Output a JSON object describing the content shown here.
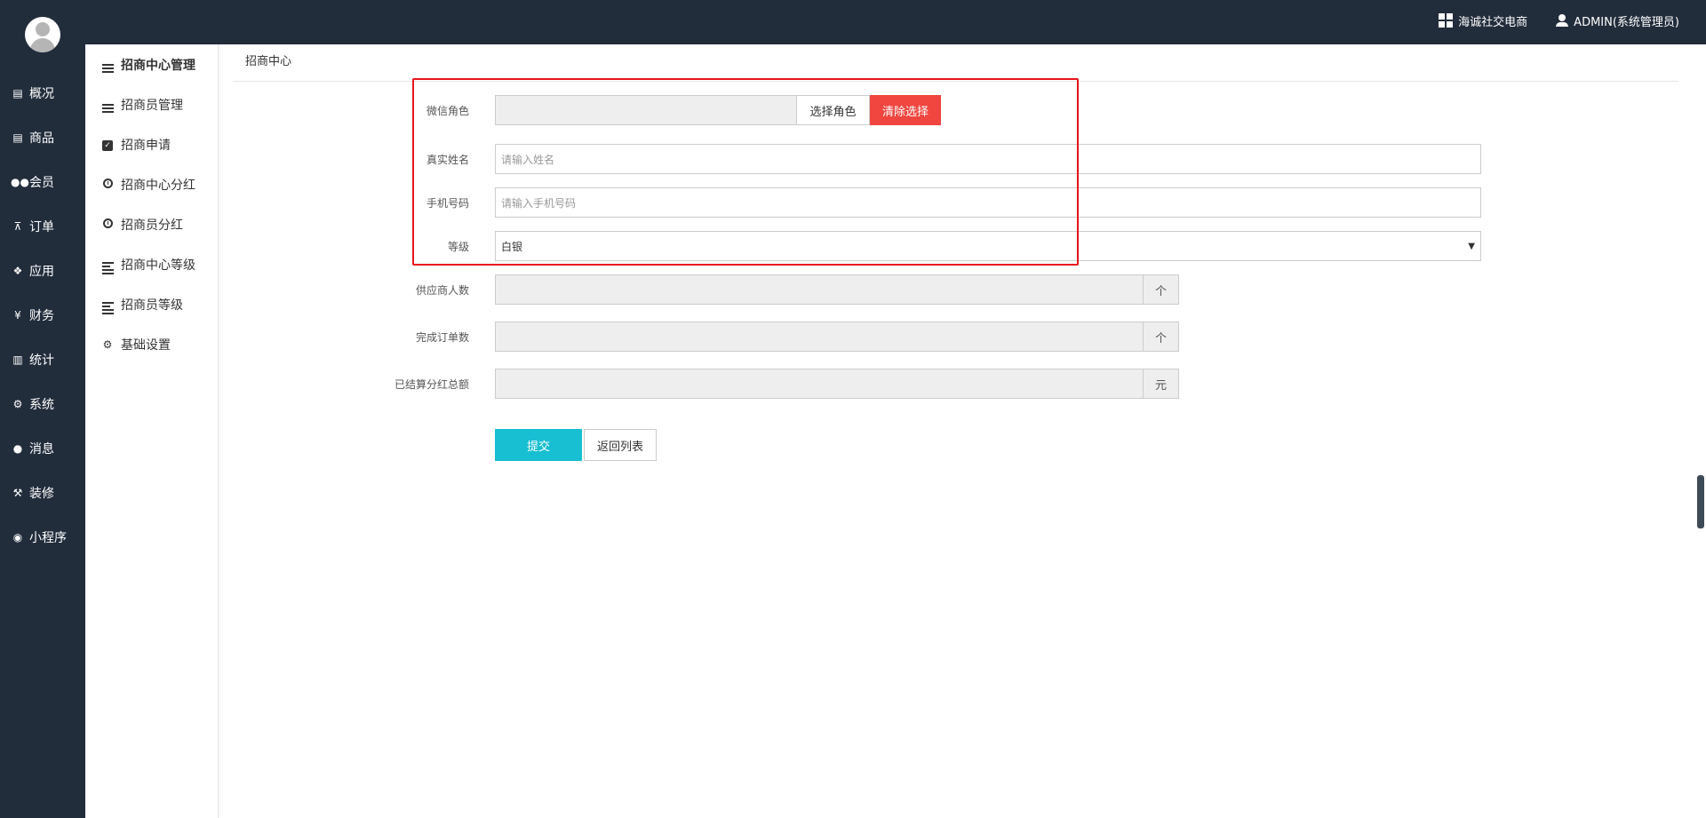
{
  "header": {
    "shop_name": "海诚社交电商",
    "user": "ADMIN(系统管理员)"
  },
  "sidebar": {
    "items": [
      {
        "label": "概况",
        "icon": "archive-icon"
      },
      {
        "label": "商品",
        "icon": "archive-icon"
      },
      {
        "label": "会员",
        "icon": "users-icon"
      },
      {
        "label": "订单",
        "icon": "cart-icon"
      },
      {
        "label": "应用",
        "icon": "cubes-icon"
      },
      {
        "label": "财务",
        "icon": "yen-icon"
      },
      {
        "label": "统计",
        "icon": "bar-chart-icon"
      },
      {
        "label": "系统",
        "icon": "gears-icon"
      },
      {
        "label": "消息",
        "icon": "comment-icon"
      },
      {
        "label": "装修",
        "icon": "gavel-icon"
      },
      {
        "label": "小程序",
        "icon": "wechat-icon"
      }
    ]
  },
  "submenu": {
    "items": [
      {
        "label": "招商中心管理",
        "icon": "list-icon",
        "active": true
      },
      {
        "label": "招商员管理",
        "icon": "list-icon"
      },
      {
        "label": "招商申请",
        "icon": "check-square-icon"
      },
      {
        "label": "招商中心分红",
        "icon": "clock-icon"
      },
      {
        "label": "招商员分红",
        "icon": "clock-icon"
      },
      {
        "label": "招商中心等级",
        "icon": "align-left-icon"
      },
      {
        "label": "招商员等级",
        "icon": "align-left-icon"
      },
      {
        "label": "基础设置",
        "icon": "gears-icon"
      }
    ]
  },
  "breadcrumb": "招商中心",
  "form": {
    "wechat_role": {
      "label": "微信角色",
      "value": "",
      "select_btn": "选择角色",
      "clear_btn": "清除选择"
    },
    "real_name": {
      "label": "真实姓名",
      "placeholder": "请输入姓名"
    },
    "phone": {
      "label": "手机号码",
      "placeholder": "请输入手机号码"
    },
    "level": {
      "label": "等级",
      "value": "白银"
    },
    "supplier_count": {
      "label": "供应商人数",
      "value": "",
      "unit": "个"
    },
    "order_count": {
      "label": "完成订单数",
      "value": "",
      "unit": "个"
    },
    "settled_dividend": {
      "label": "已结算分红总额",
      "value": "",
      "unit": "元"
    },
    "submit_btn": "提交",
    "back_btn": "返回列表"
  },
  "colors": {
    "sidebar_bg": "#222d3c",
    "danger": "#f0463f",
    "primary": "#18bed2",
    "highlight": "#e8141a"
  }
}
